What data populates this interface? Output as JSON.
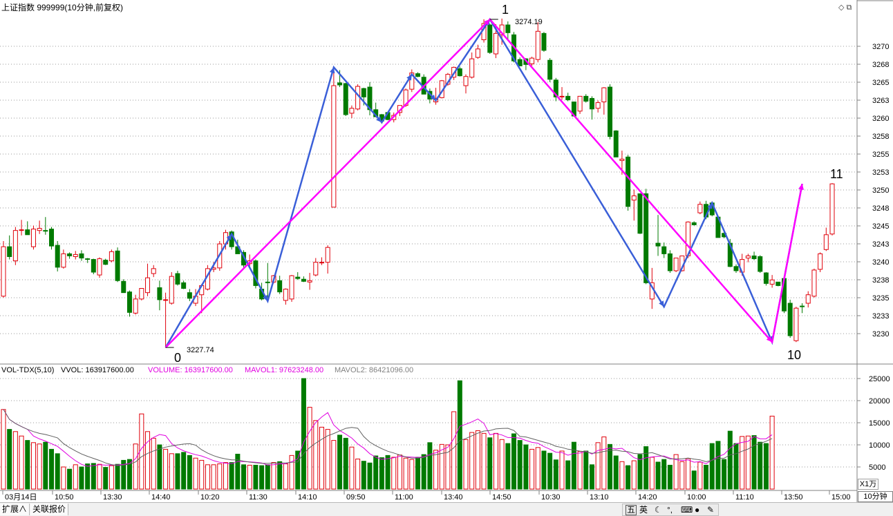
{
  "header": {
    "title": "上证指数 999999(10分钟,前复权)",
    "window_icons": [
      "diamond-icon",
      "restore-icon"
    ]
  },
  "price_axis": {
    "labels": [
      "3270",
      "3268",
      "3265",
      "3263",
      "3260",
      "3258",
      "3255",
      "3253",
      "3250",
      "3248",
      "3245",
      "3243",
      "3240",
      "3238",
      "3235",
      "3233",
      "3230"
    ]
  },
  "volume_axis": {
    "labels": [
      "25000",
      "20000",
      "15000",
      "10000",
      "5000"
    ],
    "unit_button": "X1万"
  },
  "volume_header": {
    "name": "VOL-TDX(5,10)",
    "vvol": "VVOL: 163917600.00",
    "volume": "VOLUME: 163917600.00",
    "mavol1": "MAVOL1: 97623248.00",
    "mavol2": "MAVOL2: 86421096.00"
  },
  "time_axis": {
    "labels": [
      "03月14日",
      "10:50",
      "13:30",
      "14:40",
      "10:20",
      "11:30",
      "14:10",
      "09:50",
      "11:00",
      "13:40",
      "14:50",
      "10:30",
      "13:10",
      "14:20",
      "10:00",
      "11:10",
      "13:50",
      "15:00"
    ]
  },
  "period": "10分钟",
  "annotations": {
    "wave_labels": [
      "0",
      "1",
      "10",
      "11"
    ],
    "low_value": "3227.74",
    "high_value": "3274.19"
  },
  "bottom_bar": {
    "tabs": [
      "扩展∧",
      "关联报价"
    ],
    "ime": [
      "五",
      "英"
    ]
  },
  "colors": {
    "up": "#e0000a",
    "down": "#007a00",
    "wave_major": "#ff00ff",
    "wave_minor": "#3a5fd8",
    "ma1": "#e000e0",
    "ma2": "#606060"
  },
  "chart_data": {
    "type": "candlestick",
    "interval": "10分钟",
    "ylim": [
      3226,
      3276
    ],
    "candles": [
      {
        "o": 3235.0,
        "h": 3242.8,
        "l": 3234.8,
        "c": 3242.0
      },
      {
        "o": 3242.0,
        "h": 3243.6,
        "l": 3240.2,
        "c": 3240.6
      },
      {
        "o": 3240.0,
        "h": 3244.8,
        "l": 3239.4,
        "c": 3244.3
      },
      {
        "o": 3244.3,
        "h": 3245.8,
        "l": 3243.6,
        "c": 3244.4
      },
      {
        "o": 3244.4,
        "h": 3245.6,
        "l": 3243.7,
        "c": 3243.7
      },
      {
        "o": 3242.0,
        "h": 3245.0,
        "l": 3241.6,
        "c": 3244.5
      },
      {
        "o": 3244.3,
        "h": 3245.7,
        "l": 3243.8,
        "c": 3244.6
      },
      {
        "o": 3244.3,
        "h": 3246.2,
        "l": 3243.7,
        "c": 3244.2
      },
      {
        "o": 3244.5,
        "h": 3244.8,
        "l": 3241.6,
        "c": 3242.1
      },
      {
        "o": 3242.2,
        "h": 3242.8,
        "l": 3238.5,
        "c": 3239.1
      },
      {
        "o": 3239.1,
        "h": 3241.6,
        "l": 3238.9,
        "c": 3241.0
      },
      {
        "o": 3241.0,
        "h": 3241.2,
        "l": 3240.3,
        "c": 3240.7
      },
      {
        "o": 3240.6,
        "h": 3241.4,
        "l": 3240.2,
        "c": 3240.9
      },
      {
        "o": 3241.0,
        "h": 3241.5,
        "l": 3240.0,
        "c": 3240.4
      },
      {
        "o": 3240.3,
        "h": 3240.4,
        "l": 3239.7,
        "c": 3240.2
      },
      {
        "o": 3240.2,
        "h": 3240.3,
        "l": 3238.1,
        "c": 3238.4
      },
      {
        "o": 3238.0,
        "h": 3240.5,
        "l": 3237.6,
        "c": 3240.3
      },
      {
        "o": 3240.1,
        "h": 3240.3,
        "l": 3239.4,
        "c": 3239.5
      },
      {
        "o": 3240.0,
        "h": 3241.6,
        "l": 3239.8,
        "c": 3241.3
      },
      {
        "o": 3241.4,
        "h": 3241.9,
        "l": 3237.0,
        "c": 3237.2
      },
      {
        "o": 3237.1,
        "h": 3237.4,
        "l": 3235.5,
        "c": 3235.5
      },
      {
        "o": 3235.6,
        "h": 3235.8,
        "l": 3232.1,
        "c": 3232.7
      },
      {
        "o": 3232.6,
        "h": 3235.2,
        "l": 3232.4,
        "c": 3234.6
      },
      {
        "o": 3234.6,
        "h": 3236.0,
        "l": 3234.4,
        "c": 3236.1
      },
      {
        "o": 3235.5,
        "h": 3239.6,
        "l": 3235.0,
        "c": 3237.6
      },
      {
        "o": 3238.2,
        "h": 3239.4,
        "l": 3237.7,
        "c": 3238.9
      },
      {
        "o": 3236.2,
        "h": 3237.2,
        "l": 3233.0,
        "c": 3234.5
      },
      {
        "o": 3234.5,
        "h": 3235.5,
        "l": 3227.7,
        "c": 3234.5
      },
      {
        "o": 3234.0,
        "h": 3238.4,
        "l": 3233.8,
        "c": 3237.8
      },
      {
        "o": 3238.2,
        "h": 3238.6,
        "l": 3236.5,
        "c": 3236.7
      },
      {
        "o": 3236.9,
        "h": 3237.2,
        "l": 3236.0,
        "c": 3236.1
      },
      {
        "o": 3235.5,
        "h": 3236.0,
        "l": 3234.3,
        "c": 3234.7
      },
      {
        "o": 3234.0,
        "h": 3236.0,
        "l": 3233.6,
        "c": 3235.0
      },
      {
        "o": 3235.2,
        "h": 3236.7,
        "l": 3232.6,
        "c": 3236.5
      },
      {
        "o": 3236.0,
        "h": 3239.4,
        "l": 3235.8,
        "c": 3238.9
      },
      {
        "o": 3238.8,
        "h": 3239.8,
        "l": 3238.4,
        "c": 3239.0
      },
      {
        "o": 3239.0,
        "h": 3242.8,
        "l": 3238.6,
        "c": 3242.4
      },
      {
        "o": 3242.4,
        "h": 3244.4,
        "l": 3241.6,
        "c": 3244.0
      },
      {
        "o": 3244.1,
        "h": 3244.3,
        "l": 3241.6,
        "c": 3242.0
      },
      {
        "o": 3242.0,
        "h": 3243.0,
        "l": 3241.0,
        "c": 3241.0
      },
      {
        "o": 3241.2,
        "h": 3241.5,
        "l": 3238.8,
        "c": 3239.4
      },
      {
        "o": 3239.6,
        "h": 3240.9,
        "l": 3239.2,
        "c": 3240.0
      },
      {
        "o": 3240.0,
        "h": 3240.2,
        "l": 3236.1,
        "c": 3236.5
      },
      {
        "o": 3236.0,
        "h": 3236.9,
        "l": 3234.4,
        "c": 3234.6
      },
      {
        "o": 3237.0,
        "h": 3239.7,
        "l": 3234.8,
        "c": 3236.9
      },
      {
        "o": 3237.0,
        "h": 3238.0,
        "l": 3236.8,
        "c": 3237.9
      },
      {
        "o": 3237.2,
        "h": 3237.9,
        "l": 3235.3,
        "c": 3235.6
      },
      {
        "o": 3234.4,
        "h": 3236.1,
        "l": 3233.8,
        "c": 3236.0
      },
      {
        "o": 3234.6,
        "h": 3238.0,
        "l": 3234.2,
        "c": 3237.9
      },
      {
        "o": 3237.7,
        "h": 3238.4,
        "l": 3237.3,
        "c": 3237.5
      },
      {
        "o": 3237.4,
        "h": 3237.8,
        "l": 3237.0,
        "c": 3237.1
      },
      {
        "o": 3237.0,
        "h": 3238.3,
        "l": 3235.9,
        "c": 3237.2
      },
      {
        "o": 3238.0,
        "h": 3240.4,
        "l": 3237.8,
        "c": 3239.8
      },
      {
        "o": 3239.7,
        "h": 3240.5,
        "l": 3239.4,
        "c": 3239.8
      },
      {
        "o": 3239.8,
        "h": 3242.2,
        "l": 3238.2,
        "c": 3241.9
      },
      {
        "o": 3247.6,
        "h": 3267.4,
        "l": 3247.6,
        "c": 3264.8
      },
      {
        "o": 3265.2,
        "h": 3267.0,
        "l": 3264.6,
        "c": 3264.9
      },
      {
        "o": 3265.1,
        "h": 3265.2,
        "l": 3260.5,
        "c": 3260.7
      },
      {
        "o": 3260.9,
        "h": 3262.0,
        "l": 3260.2,
        "c": 3261.6
      },
      {
        "o": 3261.5,
        "h": 3265.0,
        "l": 3261.3,
        "c": 3264.7
      },
      {
        "o": 3264.4,
        "h": 3264.5,
        "l": 3262.0,
        "c": 3263.2
      },
      {
        "o": 3264.6,
        "h": 3265.3,
        "l": 3260.6,
        "c": 3261.4
      },
      {
        "o": 3261.4,
        "h": 3262.4,
        "l": 3260.4,
        "c": 3260.4
      },
      {
        "o": 3260.7,
        "h": 3260.8,
        "l": 3259.4,
        "c": 3259.8
      },
      {
        "o": 3261.0,
        "h": 3261.1,
        "l": 3259.9,
        "c": 3260.0
      },
      {
        "o": 3260.0,
        "h": 3261.0,
        "l": 3259.6,
        "c": 3260.6
      },
      {
        "o": 3261.0,
        "h": 3262.0,
        "l": 3260.5,
        "c": 3262.0
      },
      {
        "o": 3262.0,
        "h": 3264.4,
        "l": 3261.8,
        "c": 3264.2
      },
      {
        "o": 3264.3,
        "h": 3267.1,
        "l": 3263.9,
        "c": 3266.6
      },
      {
        "o": 3266.5,
        "h": 3266.7,
        "l": 3266.0,
        "c": 3266.1
      },
      {
        "o": 3266.0,
        "h": 3266.4,
        "l": 3263.6,
        "c": 3263.6
      },
      {
        "o": 3264.0,
        "h": 3264.4,
        "l": 3262.3,
        "c": 3262.9
      },
      {
        "o": 3262.5,
        "h": 3264.5,
        "l": 3262.1,
        "c": 3263.0
      },
      {
        "o": 3263.1,
        "h": 3265.6,
        "l": 3263.0,
        "c": 3265.5
      },
      {
        "o": 3265.0,
        "h": 3266.6,
        "l": 3264.8,
        "c": 3266.4
      },
      {
        "o": 3266.0,
        "h": 3267.5,
        "l": 3265.6,
        "c": 3267.4
      },
      {
        "o": 3267.2,
        "h": 3267.5,
        "l": 3266.1,
        "c": 3266.2
      },
      {
        "o": 3264.8,
        "h": 3266.4,
        "l": 3263.7,
        "c": 3266.1
      },
      {
        "o": 3266.0,
        "h": 3269.5,
        "l": 3265.8,
        "c": 3268.6
      },
      {
        "o": 3268.8,
        "h": 3270.6,
        "l": 3268.6,
        "c": 3270.0
      },
      {
        "o": 3271.3,
        "h": 3274.2,
        "l": 3270.9,
        "c": 3273.6
      },
      {
        "o": 3273.4,
        "h": 3273.6,
        "l": 3269.3,
        "c": 3269.5
      },
      {
        "o": 3269.3,
        "h": 3273.5,
        "l": 3268.7,
        "c": 3272.2
      },
      {
        "o": 3272.0,
        "h": 3274.3,
        "l": 3270.6,
        "c": 3273.4
      },
      {
        "o": 3273.4,
        "h": 3273.9,
        "l": 3271.2,
        "c": 3272.3
      },
      {
        "o": 3272.0,
        "h": 3272.4,
        "l": 3268.1,
        "c": 3268.3
      },
      {
        "o": 3268.5,
        "h": 3268.8,
        "l": 3267.6,
        "c": 3267.6
      },
      {
        "o": 3268.6,
        "h": 3268.7,
        "l": 3267.0,
        "c": 3267.8
      },
      {
        "o": 3267.9,
        "h": 3268.9,
        "l": 3267.6,
        "c": 3268.7
      },
      {
        "o": 3268.5,
        "h": 3273.8,
        "l": 3268.1,
        "c": 3272.5
      },
      {
        "o": 3272.2,
        "h": 3272.4,
        "l": 3269.6,
        "c": 3269.8
      },
      {
        "o": 3268.4,
        "h": 3268.7,
        "l": 3265.3,
        "c": 3265.7
      },
      {
        "o": 3265.6,
        "h": 3265.9,
        "l": 3262.6,
        "c": 3263.2
      },
      {
        "o": 3263.2,
        "h": 3264.6,
        "l": 3262.8,
        "c": 3263.3
      },
      {
        "o": 3263.3,
        "h": 3263.8,
        "l": 3262.6,
        "c": 3262.8
      },
      {
        "o": 3262.5,
        "h": 3262.5,
        "l": 3260.4,
        "c": 3260.5
      },
      {
        "o": 3261.2,
        "h": 3263.3,
        "l": 3260.8,
        "c": 3263.3
      },
      {
        "o": 3263.3,
        "h": 3263.6,
        "l": 3262.4,
        "c": 3262.6
      },
      {
        "o": 3263.0,
        "h": 3263.3,
        "l": 3260.0,
        "c": 3261.5
      },
      {
        "o": 3261.6,
        "h": 3262.7,
        "l": 3261.0,
        "c": 3262.4
      },
      {
        "o": 3262.5,
        "h": 3264.6,
        "l": 3260.7,
        "c": 3264.5
      },
      {
        "o": 3264.6,
        "h": 3265.0,
        "l": 3257.2,
        "c": 3257.6
      },
      {
        "o": 3258.4,
        "h": 3258.5,
        "l": 3254.7,
        "c": 3254.7
      },
      {
        "o": 3254.2,
        "h": 3255.6,
        "l": 3252.2,
        "c": 3254.4
      },
      {
        "o": 3254.7,
        "h": 3255.0,
        "l": 3247.1,
        "c": 3247.7
      },
      {
        "o": 3248.6,
        "h": 3250.1,
        "l": 3245.7,
        "c": 3249.2
      },
      {
        "o": 3249.5,
        "h": 3249.5,
        "l": 3243.8,
        "c": 3243.9
      },
      {
        "o": 3249.5,
        "h": 3250.2,
        "l": 3236.7,
        "c": 3236.9
      },
      {
        "o": 3234.6,
        "h": 3239.0,
        "l": 3233.2,
        "c": 3236.9
      },
      {
        "o": 3242.5,
        "h": 3246.5,
        "l": 3240.7,
        "c": 3242.1
      },
      {
        "o": 3242.0,
        "h": 3242.6,
        "l": 3240.4,
        "c": 3241.0
      },
      {
        "o": 3241.0,
        "h": 3241.5,
        "l": 3238.3,
        "c": 3238.6
      },
      {
        "o": 3238.6,
        "h": 3240.4,
        "l": 3238.4,
        "c": 3240.4
      },
      {
        "o": 3238.6,
        "h": 3240.7,
        "l": 3238.5,
        "c": 3240.7
      },
      {
        "o": 3240.7,
        "h": 3245.6,
        "l": 3240.4,
        "c": 3245.5
      },
      {
        "o": 3245.4,
        "h": 3245.6,
        "l": 3245.0,
        "c": 3245.1
      },
      {
        "o": 3246.8,
        "h": 3248.4,
        "l": 3246.6,
        "c": 3248.0
      },
      {
        "o": 3248.0,
        "h": 3248.5,
        "l": 3245.9,
        "c": 3246.2
      },
      {
        "o": 3248.2,
        "h": 3248.4,
        "l": 3246.3,
        "c": 3246.5
      },
      {
        "o": 3246.2,
        "h": 3246.3,
        "l": 3243.3,
        "c": 3243.3
      },
      {
        "o": 3243.9,
        "h": 3244.2,
        "l": 3243.2,
        "c": 3243.4
      },
      {
        "o": 3242.5,
        "h": 3243.1,
        "l": 3239.1,
        "c": 3239.2
      },
      {
        "o": 3239.2,
        "h": 3239.5,
        "l": 3238.3,
        "c": 3238.6
      },
      {
        "o": 3238.4,
        "h": 3241.0,
        "l": 3237.9,
        "c": 3240.2
      },
      {
        "o": 3240.4,
        "h": 3241.0,
        "l": 3239.8,
        "c": 3240.7
      },
      {
        "o": 3240.7,
        "h": 3241.3,
        "l": 3240.1,
        "c": 3240.3
      },
      {
        "o": 3240.6,
        "h": 3240.8,
        "l": 3238.3,
        "c": 3238.5
      },
      {
        "o": 3238.3,
        "h": 3238.4,
        "l": 3236.5,
        "c": 3236.8
      },
      {
        "o": 3236.7,
        "h": 3238.0,
        "l": 3236.2,
        "c": 3237.3
      },
      {
        "o": 3237.0,
        "h": 3237.0,
        "l": 3236.4,
        "c": 3236.5
      },
      {
        "o": 3237.5,
        "h": 3237.5,
        "l": 3232.6,
        "c": 3232.9
      },
      {
        "o": 3234.0,
        "h": 3234.5,
        "l": 3229.1,
        "c": 3229.4
      },
      {
        "o": 3228.7,
        "h": 3233.5,
        "l": 3228.5,
        "c": 3233.3
      },
      {
        "o": 3233.6,
        "h": 3234.0,
        "l": 3232.6,
        "c": 3233.5
      },
      {
        "o": 3234.0,
        "h": 3235.7,
        "l": 3233.4,
        "c": 3235.2
      },
      {
        "o": 3235.0,
        "h": 3238.9,
        "l": 3234.8,
        "c": 3238.7
      },
      {
        "o": 3238.8,
        "h": 3241.2,
        "l": 3238.4,
        "c": 3241.0
      },
      {
        "o": 3241.6,
        "h": 3244.7,
        "l": 3241.4,
        "c": 3243.7
      },
      {
        "o": 3243.8,
        "h": 3251.0,
        "l": 3243.6,
        "c": 3250.9
      }
    ],
    "volume_x10k": [
      18000,
      13500,
      13000,
      12000,
      11000,
      10500,
      10200,
      10600,
      9000,
      8000,
      5000,
      4500,
      5500,
      5000,
      5700,
      5800,
      5600,
      4900,
      5300,
      5600,
      6500,
      6700,
      10200,
      17000,
      13000,
      11500,
      10000,
      9000,
      8000,
      8000,
      8300,
      7600,
      7000,
      6500,
      5500,
      5500,
      5700,
      6000,
      6000,
      7900,
      5500,
      5400,
      5400,
      5300,
      5500,
      6000,
      6200,
      5700,
      7600,
      8600,
      25000,
      18500,
      15500,
      14000,
      13500,
      11000,
      12200,
      11500,
      9500,
      6800,
      6300,
      5900,
      7500,
      7100,
      7600,
      7200,
      7700,
      7000,
      6700,
      7200,
      7800,
      10500,
      8800,
      10100,
      10000,
      17500,
      24500,
      11200,
      12800,
      13200,
      12600,
      11600,
      12600,
      11200,
      10300,
      12500,
      11000,
      10000,
      9000,
      9400,
      8600,
      8100,
      6600,
      8600,
      6400,
      10600,
      8500,
      8600,
      5500,
      10500,
      11800,
      10100,
      7500,
      6200,
      5300,
      6400,
      7800,
      9600,
      7200,
      6100,
      6700,
      5400,
      7800,
      6200,
      6900,
      4100,
      6100,
      5400,
      10300,
      10800,
      6700,
      13100,
      10300,
      11900,
      12000,
      12100,
      10600,
      10300,
      16500
    ]
  }
}
